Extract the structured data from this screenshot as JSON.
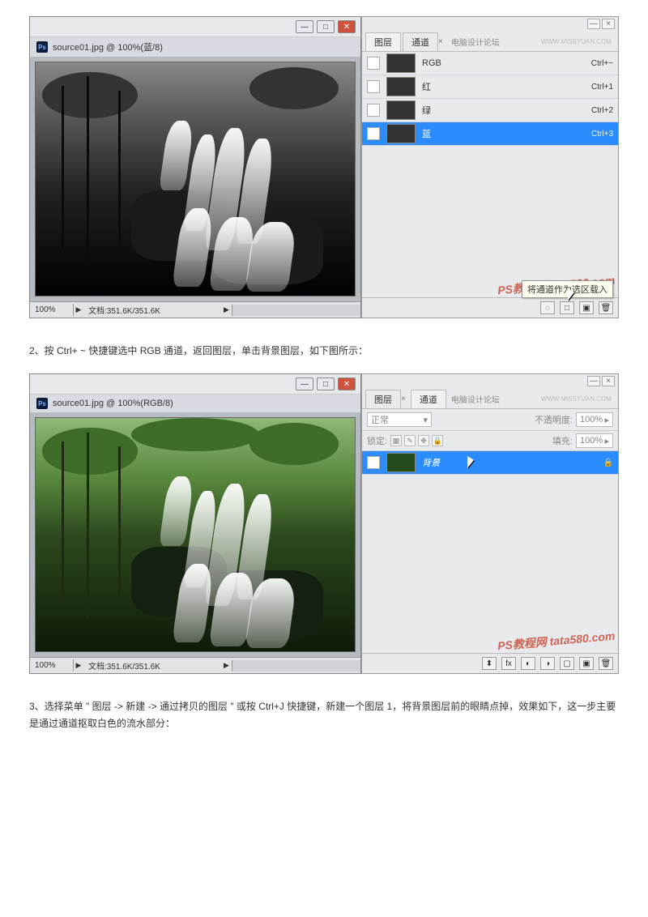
{
  "fig1": {
    "title": "source01.jpg @ 100%(蓝/8)",
    "zoom": "100%",
    "doc": "文档:351.6K/351.6K",
    "panel_tabs": {
      "layers": "图层",
      "channels": "通道",
      "forum": "电脑设计论坛",
      "url": "WWW.MISSYUAN.COM"
    },
    "channels": [
      {
        "name": "RGB",
        "short": "Ctrl+~"
      },
      {
        "name": "红",
        "short": "Ctrl+1"
      },
      {
        "name": "绿",
        "short": "Ctrl+2"
      },
      {
        "name": "蓝",
        "short": "Ctrl+3",
        "selected": true,
        "eye": true
      }
    ],
    "tooltip": "将通道作为选区载入",
    "watermark": "PS教程网  tata580.com"
  },
  "step2": "2、按 Ctrl+ ~ 快捷键选中   RGB 通道，返回图层，单击背景图层，如下图所示：",
  "fig2": {
    "title": "source01.jpg @ 100%(RGB/8)",
    "zoom": "100%",
    "doc": "文档:351.6K/351.6K",
    "panel_tabs": {
      "layers": "图层",
      "channels": "通道",
      "forum": "电脑设计论坛",
      "url": "WWW.MISSYUAN.COM"
    },
    "blend": {
      "mode": "正常",
      "opacity_label": "不透明度:",
      "opacity": "100%",
      "lock": "锁定:",
      "fill_label": "填充:",
      "fill": "100%"
    },
    "layers": [
      {
        "name": "背景",
        "eye": true,
        "selected": true,
        "locked": true
      }
    ],
    "watermark": "PS教程网  tata580.com"
  },
  "step3": "3、选择菜单 \" 图层 -> 新建 -> 通过拷贝的图层   \" 或按 Ctrl+J 快捷键，新建一个图层    1，将背景图层前的眼睛点掉，效果如下，这一步主要是通过通道抠取白色的流水部分："
}
